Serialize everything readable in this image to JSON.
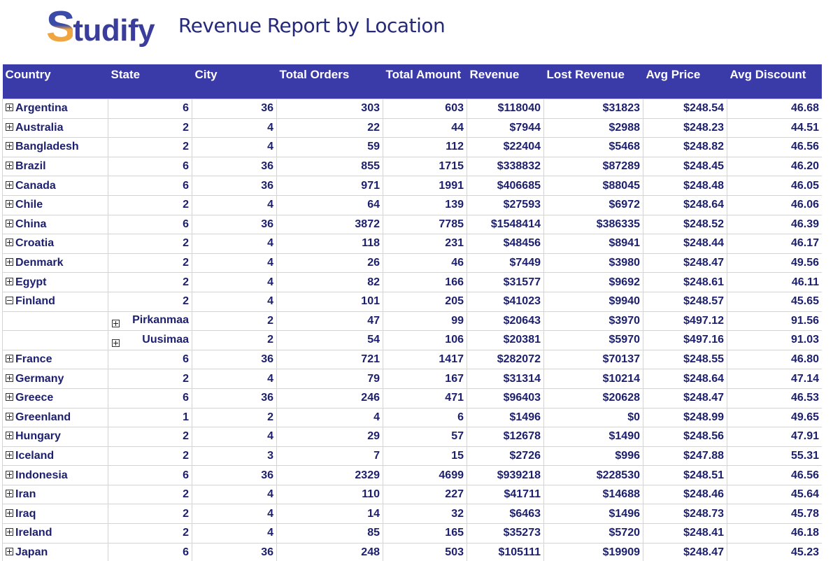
{
  "brand": {
    "logo_text": "Studify",
    "title": "Revenue Report by Location"
  },
  "colors": {
    "header_bg": "#3a3aa8",
    "header_text": "#ffffff",
    "cell_text": "#1c1f6e",
    "logo_blue": "#3a4ba8",
    "logo_orange": "#f0a640"
  },
  "columns": [
    "Country",
    "State",
    "City",
    "Total Orders",
    "Total Amount",
    "Revenue",
    "Lost Revenue",
    "Avg Price",
    "Avg Discount"
  ],
  "rows": [
    {
      "type": "country",
      "expanded": false,
      "country": "Argentina",
      "state": "6",
      "city": "36",
      "orders": "303",
      "amount": "603",
      "revenue": "$118040",
      "lost": "$31823",
      "avg_price": "$248.54",
      "avg_discount": "46.68"
    },
    {
      "type": "country",
      "expanded": false,
      "country": "Australia",
      "state": "2",
      "city": "4",
      "orders": "22",
      "amount": "44",
      "revenue": "$7944",
      "lost": "$2988",
      "avg_price": "$248.23",
      "avg_discount": "44.51"
    },
    {
      "type": "country",
      "expanded": false,
      "country": "Bangladesh",
      "state": "2",
      "city": "4",
      "orders": "59",
      "amount": "112",
      "revenue": "$22404",
      "lost": "$5468",
      "avg_price": "$248.82",
      "avg_discount": "46.56"
    },
    {
      "type": "country",
      "expanded": false,
      "country": "Brazil",
      "state": "6",
      "city": "36",
      "orders": "855",
      "amount": "1715",
      "revenue": "$338832",
      "lost": "$87289",
      "avg_price": "$248.45",
      "avg_discount": "46.20"
    },
    {
      "type": "country",
      "expanded": false,
      "country": "Canada",
      "state": "6",
      "city": "36",
      "orders": "971",
      "amount": "1991",
      "revenue": "$406685",
      "lost": "$88045",
      "avg_price": "$248.48",
      "avg_discount": "46.05"
    },
    {
      "type": "country",
      "expanded": false,
      "country": "Chile",
      "state": "2",
      "city": "4",
      "orders": "64",
      "amount": "139",
      "revenue": "$27593",
      "lost": "$6972",
      "avg_price": "$248.64",
      "avg_discount": "46.06"
    },
    {
      "type": "country",
      "expanded": false,
      "country": "China",
      "state": "6",
      "city": "36",
      "orders": "3872",
      "amount": "7785",
      "revenue": "$1548414",
      "lost": "$386335",
      "avg_price": "$248.52",
      "avg_discount": "46.39"
    },
    {
      "type": "country",
      "expanded": false,
      "country": "Croatia",
      "state": "2",
      "city": "4",
      "orders": "118",
      "amount": "231",
      "revenue": "$48456",
      "lost": "$8941",
      "avg_price": "$248.44",
      "avg_discount": "46.17"
    },
    {
      "type": "country",
      "expanded": false,
      "country": "Denmark",
      "state": "2",
      "city": "4",
      "orders": "26",
      "amount": "46",
      "revenue": "$7449",
      "lost": "$3980",
      "avg_price": "$248.47",
      "avg_discount": "49.56"
    },
    {
      "type": "country",
      "expanded": false,
      "country": "Egypt",
      "state": "2",
      "city": "4",
      "orders": "82",
      "amount": "166",
      "revenue": "$31577",
      "lost": "$9692",
      "avg_price": "$248.61",
      "avg_discount": "46.11"
    },
    {
      "type": "country",
      "expanded": true,
      "country": "Finland",
      "state": "2",
      "city": "4",
      "orders": "101",
      "amount": "205",
      "revenue": "$41023",
      "lost": "$9940",
      "avg_price": "$248.57",
      "avg_discount": "45.65"
    },
    {
      "type": "state",
      "expanded": false,
      "country": "",
      "state": "Pirkanmaa",
      "city": "2",
      "orders": "47",
      "amount": "99",
      "revenue": "$20643",
      "lost": "$3970",
      "avg_price": "$497.12",
      "avg_discount": "91.56"
    },
    {
      "type": "state",
      "expanded": false,
      "country": "",
      "state": "Uusimaa",
      "city": "2",
      "orders": "54",
      "amount": "106",
      "revenue": "$20381",
      "lost": "$5970",
      "avg_price": "$497.16",
      "avg_discount": "91.03"
    },
    {
      "type": "country",
      "expanded": false,
      "country": "France",
      "state": "6",
      "city": "36",
      "orders": "721",
      "amount": "1417",
      "revenue": "$282072",
      "lost": "$70137",
      "avg_price": "$248.55",
      "avg_discount": "46.80"
    },
    {
      "type": "country",
      "expanded": false,
      "country": "Germany",
      "state": "2",
      "city": "4",
      "orders": "79",
      "amount": "167",
      "revenue": "$31314",
      "lost": "$10214",
      "avg_price": "$248.64",
      "avg_discount": "47.14"
    },
    {
      "type": "country",
      "expanded": false,
      "country": "Greece",
      "state": "6",
      "city": "36",
      "orders": "246",
      "amount": "471",
      "revenue": "$96403",
      "lost": "$20628",
      "avg_price": "$248.47",
      "avg_discount": "46.53"
    },
    {
      "type": "country",
      "expanded": false,
      "country": "Greenland",
      "state": "1",
      "city": "2",
      "orders": "4",
      "amount": "6",
      "revenue": "$1496",
      "lost": "$0",
      "avg_price": "$248.99",
      "avg_discount": "49.65"
    },
    {
      "type": "country",
      "expanded": false,
      "country": "Hungary",
      "state": "2",
      "city": "4",
      "orders": "29",
      "amount": "57",
      "revenue": "$12678",
      "lost": "$1490",
      "avg_price": "$248.56",
      "avg_discount": "47.91"
    },
    {
      "type": "country",
      "expanded": false,
      "country": "Iceland",
      "state": "2",
      "city": "3",
      "orders": "7",
      "amount": "15",
      "revenue": "$2726",
      "lost": "$996",
      "avg_price": "$247.88",
      "avg_discount": "55.31"
    },
    {
      "type": "country",
      "expanded": false,
      "country": "Indonesia",
      "state": "6",
      "city": "36",
      "orders": "2329",
      "amount": "4699",
      "revenue": "$939218",
      "lost": "$228530",
      "avg_price": "$248.51",
      "avg_discount": "46.56"
    },
    {
      "type": "country",
      "expanded": false,
      "country": "Iran",
      "state": "2",
      "city": "4",
      "orders": "110",
      "amount": "227",
      "revenue": "$41711",
      "lost": "$14688",
      "avg_price": "$248.46",
      "avg_discount": "45.64"
    },
    {
      "type": "country",
      "expanded": false,
      "country": "Iraq",
      "state": "2",
      "city": "4",
      "orders": "14",
      "amount": "32",
      "revenue": "$6463",
      "lost": "$1496",
      "avg_price": "$248.73",
      "avg_discount": "45.78"
    },
    {
      "type": "country",
      "expanded": false,
      "country": "Ireland",
      "state": "2",
      "city": "4",
      "orders": "85",
      "amount": "165",
      "revenue": "$35273",
      "lost": "$5720",
      "avg_price": "$248.41",
      "avg_discount": "46.18"
    },
    {
      "type": "country",
      "expanded": false,
      "country": "Japan",
      "state": "6",
      "city": "36",
      "orders": "248",
      "amount": "503",
      "revenue": "$105111",
      "lost": "$19909",
      "avg_price": "$248.47",
      "avg_discount": "45.23"
    }
  ]
}
